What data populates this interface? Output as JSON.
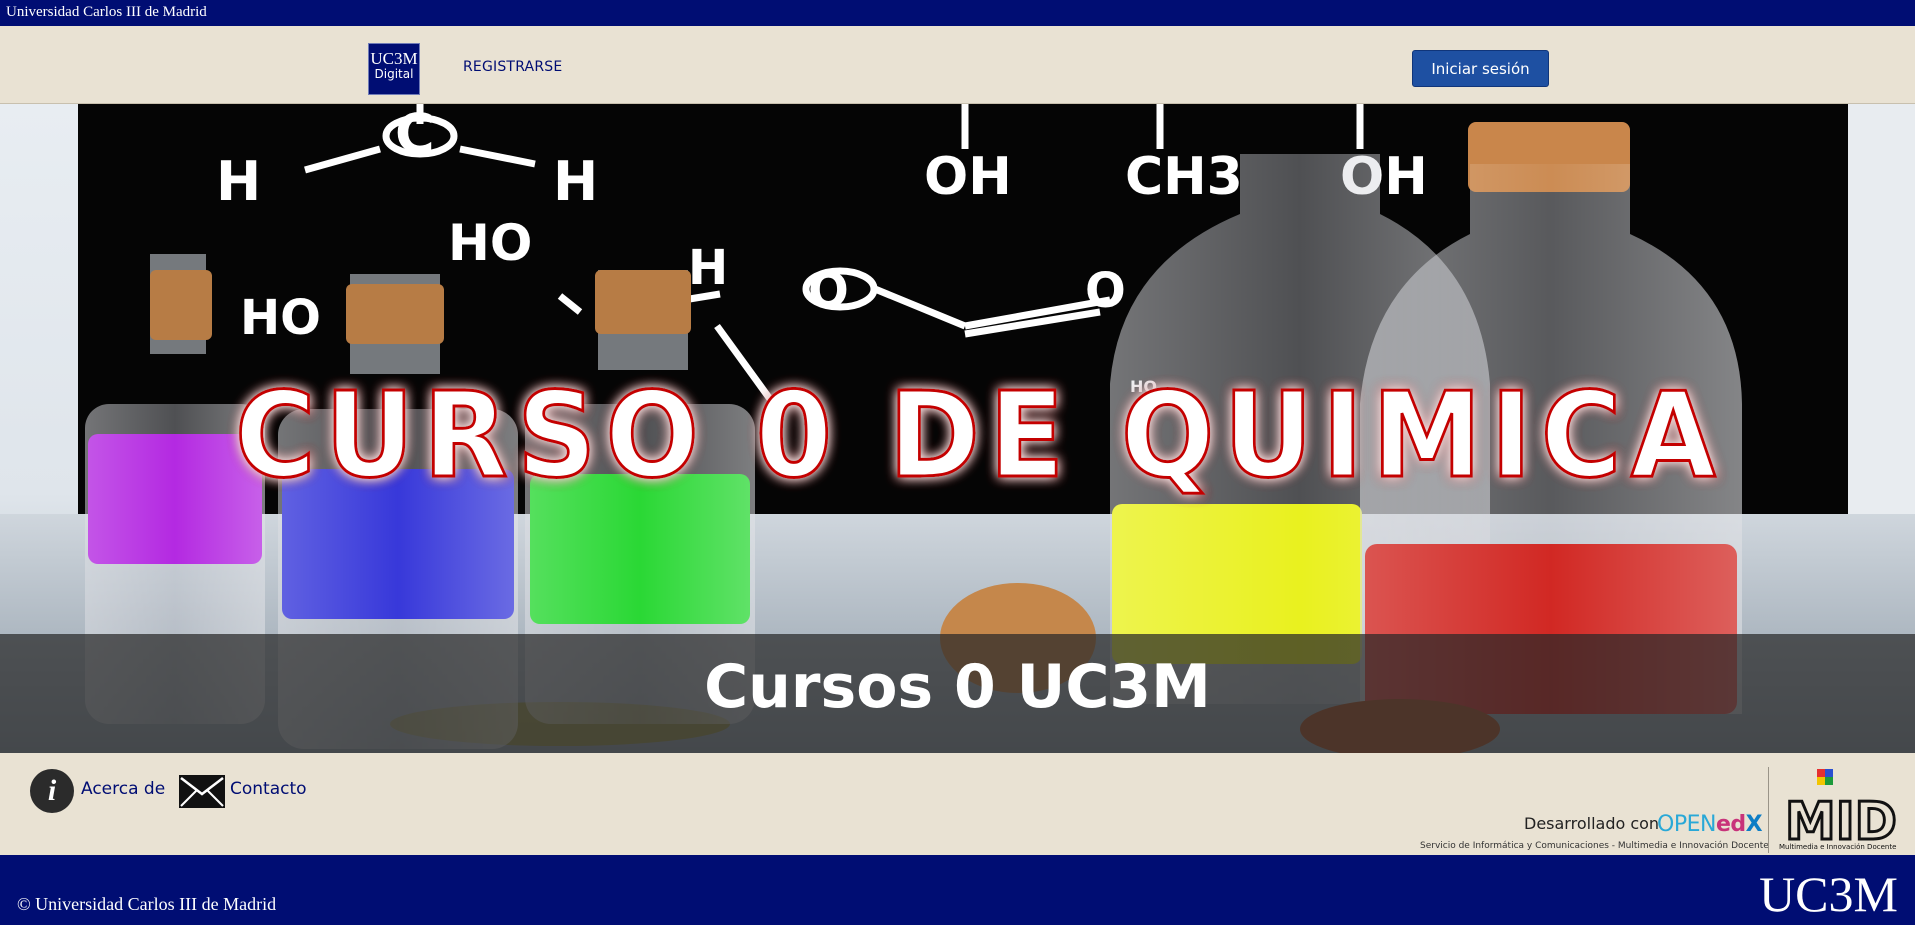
{
  "topbar": {
    "institution": "Universidad Carlos III de Madrid"
  },
  "header": {
    "logo_line1": "UC3M",
    "logo_line2": "Digital",
    "register_label": "REGISTRARSE",
    "login_label": "Iniciar sesión"
  },
  "hero": {
    "banner_text": "CURSO 0 DE QUIMICA",
    "caption": "Cursos 0 UC3M",
    "board_formula_labels": [
      "H",
      "C",
      "H",
      "HO",
      "H",
      "HO",
      "O",
      "O",
      "OH",
      "CH3",
      "OH",
      "HO"
    ]
  },
  "footer": {
    "about_label": "Acerca de",
    "contact_label": "Contacto",
    "developed_with": "Desarrollado con",
    "openedx_open": "OPEN",
    "openedx_ed": "ed",
    "openedx_x": "X",
    "service_text": "Servicio de Informática y Comunicaciones - Multimedia e Innovación Docente",
    "mid_text": "MID",
    "mid_subtitle": "Multimedia e Innovación Docente"
  },
  "bottombar": {
    "copyright": "© Universidad Carlos III de Madrid",
    "brand": "UC3M"
  },
  "colors": {
    "navy": "#000d73",
    "beige": "#e9e2d3",
    "login_button": "#1e50a2",
    "banner_text_glow": "#c40000"
  }
}
